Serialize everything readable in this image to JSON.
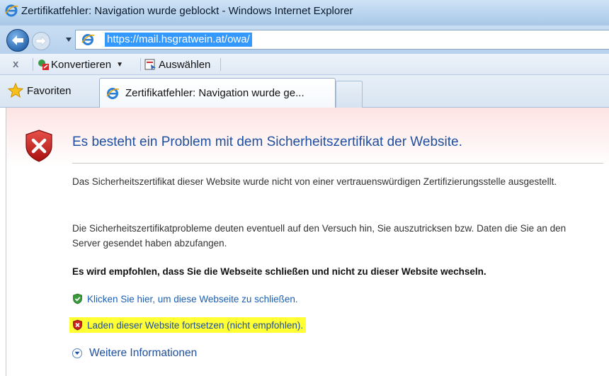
{
  "window": {
    "title": "Zertifikatfehler: Navigation wurde geblockt - Windows Internet Explorer"
  },
  "address_bar": {
    "url": "https://mail.hsgratwein.at/owa/"
  },
  "command_bar": {
    "convert_label": "Konvertieren",
    "select_label": "Auswählen"
  },
  "tabs": {
    "favorites_label": "Favoriten",
    "active_tab_label": "Zertifikatfehler: Navigation wurde ge..."
  },
  "page": {
    "heading": "Es besteht ein Problem mit dem Sicherheitszertifikat der Website.",
    "paragraph1": "Das Sicherheitszertifikat dieser Website wurde nicht von einer vertrauenswürdigen Zertifizierungsstelle ausgestellt.",
    "paragraph2": "Die Sicherheitszertifikatprobleme deuten eventuell auf den Versuch hin, Sie auszutricksen bzw. Daten die Sie an den Server gesendet haben abzufangen.",
    "recommendation": "Es wird empfohlen, dass Sie die Webseite schließen und nicht zu dieser Website wechseln.",
    "close_link": "Klicken Sie hier, um diese Webseite zu schließen.",
    "continue_link": "Laden dieser Website fortsetzen (nicht empfohlen).",
    "more_info": "Weitere Informationen"
  },
  "colors": {
    "heading_blue": "#1f4fa0",
    "link_blue": "#1a5fb4",
    "highlight_yellow": "#ffff33",
    "error_red": "#c8201e",
    "safe_green": "#2f8a2f"
  },
  "icons": {
    "title": "ie-logo-icon",
    "back": "back-arrow-icon",
    "forward": "forward-arrow-icon",
    "page": "ie-page-icon",
    "convert": "pdf-convert-icon",
    "select": "pdf-select-icon",
    "favorites": "star-icon",
    "error": "red-shield-x-icon",
    "close": "green-shield-check-icon",
    "continue": "red-shield-x-icon",
    "more": "chevron-down-circle-icon"
  }
}
